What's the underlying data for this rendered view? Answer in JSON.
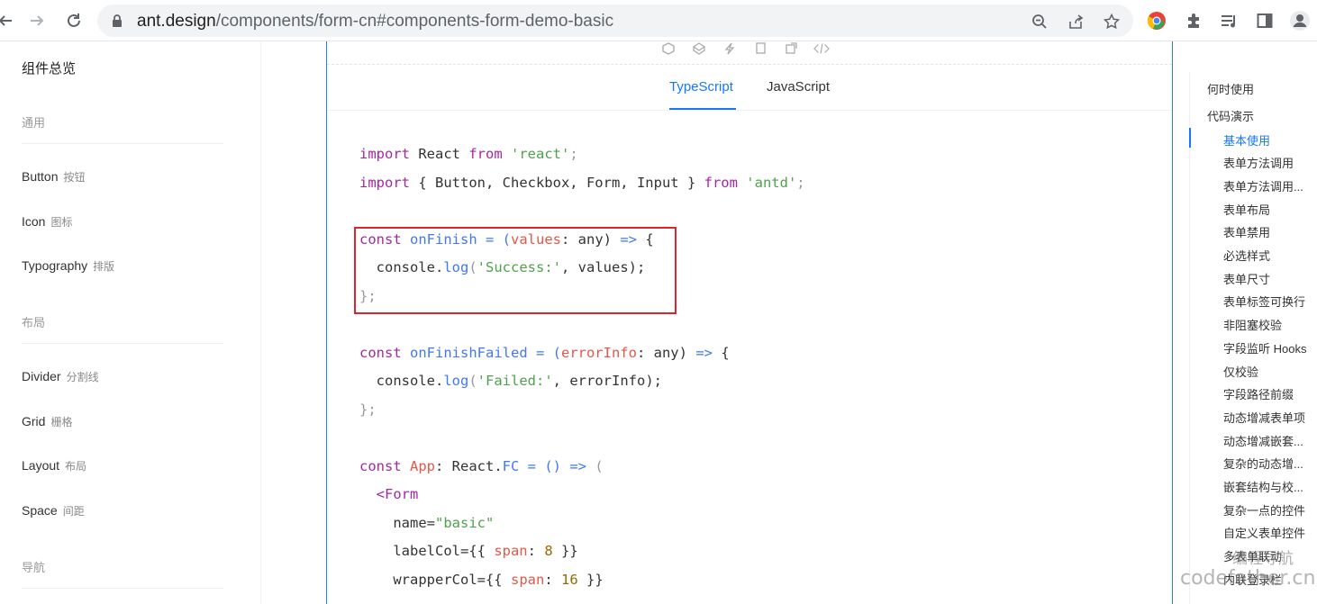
{
  "browser": {
    "url_host": "ant.design",
    "url_path": "/components/form-cn#components-form-demo-basic"
  },
  "sidebar": {
    "overview": "组件总览",
    "groups": [
      {
        "label": "通用"
      },
      {
        "label": "布局"
      },
      {
        "label": "导航"
      }
    ],
    "items": [
      {
        "en": "Button",
        "zh": "按钮"
      },
      {
        "en": "Icon",
        "zh": "图标"
      },
      {
        "en": "Typography",
        "zh": "排版"
      },
      {
        "en": "Divider",
        "zh": "分割线"
      },
      {
        "en": "Grid",
        "zh": "栅格"
      },
      {
        "en": "Layout",
        "zh": "布局"
      },
      {
        "en": "Space",
        "zh": "间距"
      }
    ]
  },
  "tabs": {
    "typescript": "TypeScript",
    "javascript": "JavaScript"
  },
  "code": {
    "l1_import": "import",
    "l1_react": " React ",
    "l1_from": "from",
    "l1_str": " 'react'",
    "l1_end": ";",
    "l2_import": "import",
    "l2_mid": " { Button, Checkbox, Form, Input } ",
    "l2_from": "from",
    "l2_str": " 'antd'",
    "l2_end": ";",
    "l3_const": "const",
    "l3_name": " onFinish",
    "l3_eq": " = (",
    "l3_param": "values",
    "l3_type": ": any) ",
    "l3_arrow": "=>",
    "l3_brace": " {",
    "l4_obj": "  console.",
    "l4_fn": "log",
    "l4_open": "(",
    "l4_str": "'Success:'",
    "l4_rest": ", values);",
    "l5": "};",
    "l6_const": "const",
    "l6_name": " onFinishFailed",
    "l6_eq": " = (",
    "l6_param": "errorInfo",
    "l6_type": ": any) ",
    "l6_arrow": "=>",
    "l6_brace": " {",
    "l7_obj": "  console.",
    "l7_fn": "log",
    "l7_open": "(",
    "l7_str": "'Failed:'",
    "l7_rest": ", errorInfo);",
    "l8": "};",
    "l9_const": "const",
    "l9_name": " App",
    "l9_colon": ": React.",
    "l9_fc": "FC",
    "l9_eq": " = () ",
    "l9_arrow": "=>",
    "l9_paren": " (",
    "l10_tag": "  <Form",
    "l11_attr": "    name=",
    "l11_val": "\"basic\"",
    "l12_attr": "    labelCol={{ ",
    "l12_key": "span",
    "l12_colon": ": ",
    "l12_num": "8",
    "l12_end": " }}",
    "l13_attr": "    wrapperCol={{ ",
    "l13_key": "span",
    "l13_colon": ": ",
    "l13_num": "16",
    "l13_end": " }}"
  },
  "anchor": {
    "top_items": [
      "何时使用",
      "代码演示"
    ],
    "sub_items": [
      "基本使用",
      "表单方法调用",
      "表单方法调用...",
      "表单布局",
      "表单禁用",
      "必选样式",
      "表单尺寸",
      "表单标签可换行",
      "非阻塞校验",
      "字段监听 Hooks",
      "仅校验",
      "字段路径前缀",
      "动态增减表单项",
      "动态增减嵌套...",
      "复杂的动态增...",
      "嵌套结构与校...",
      "复杂一点的控件",
      "自定义表单控件",
      "多表单联动",
      "内联登录栏"
    ]
  },
  "watermark": {
    "line1": "编程导航",
    "line2": "codefather.cn"
  },
  "colors": {
    "accent": "#1677ff",
    "highlight_border": "#d9262f",
    "panel_border": "#2c7be5"
  }
}
